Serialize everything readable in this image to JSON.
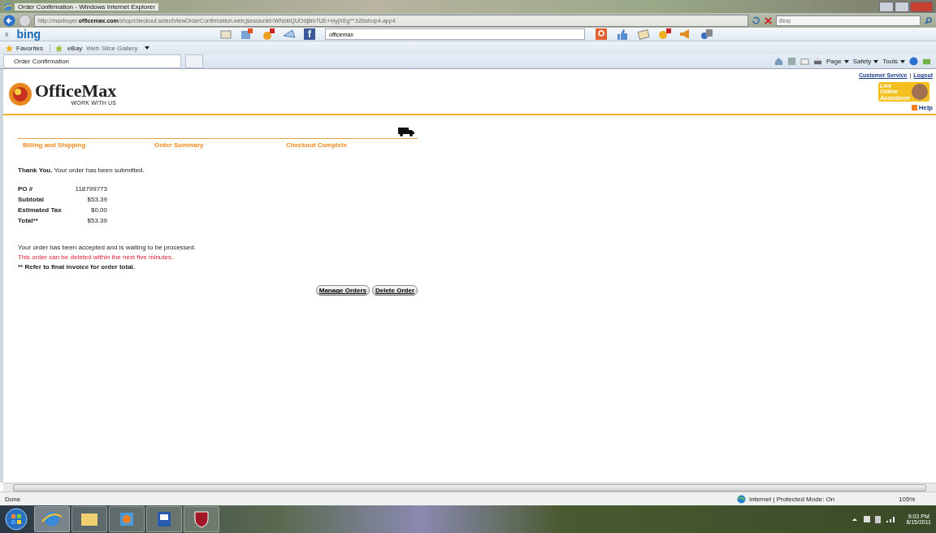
{
  "window": {
    "title": "Order Confirmation - Windows Internet Explorer"
  },
  "address_bar": {
    "url_parts": [
      {
        "text": "http://maxbuyer.",
        "emphasis": false
      },
      {
        "text": "officemax.com",
        "emphasis": true
      },
      {
        "text": "/shop/checkout.selectViewOrderConfirmation.web;jsessionid=WNzklQUOdj8m7UE+myjXEg**.b2bshop4-app4",
        "emphasis": false
      }
    ]
  },
  "search_box": {
    "placeholder": "Bing"
  },
  "bing_bar": {
    "close_glyph": "x",
    "logo": "bing",
    "search_value": "officemax",
    "facebook_glyph": "f"
  },
  "favorites_bar": {
    "favorites": "Favorites",
    "items": [
      "eBay",
      "Web Slice Gallery"
    ]
  },
  "tabs": [
    {
      "label": "Order Confirmation",
      "selected": true
    }
  ],
  "command_bar": [
    "Page",
    "Safety",
    "Tools"
  ],
  "page": {
    "logo": "OfficeMax",
    "tagline": "WORK WITH US",
    "header_links": [
      "Customer Service",
      "Logout"
    ],
    "link_separator": "|",
    "assistance": [
      "Live",
      "Online",
      "Assistance"
    ],
    "help": "Help",
    "steps": [
      "Billing and Shipping",
      "Order Summary",
      "Checkout Complete"
    ],
    "thank_you": "**Thank You.** Your order has been submitted.",
    "summary": [
      {
        "label": "PO #",
        "value": "118799773"
      },
      {
        "label": "Subtotal",
        "value": "$53.39"
      },
      {
        "label": "Estimated Tax",
        "value": "$0.00"
      },
      {
        "label": "Total**",
        "value": "$53.39"
      }
    ],
    "messages": [
      {
        "kind": "info",
        "text": "Your order has been accepted and is waiting to be processed."
      },
      {
        "kind": "warning",
        "text": "This order can be deleted within the next five minutes."
      },
      {
        "kind": "note",
        "text": "** Refer to final invoice for order total."
      }
    ],
    "buttons": [
      "Manage Orders",
      "Delete Order"
    ]
  },
  "status_bar": {
    "status": "Done",
    "zone": "Internet | Protected Mode: On",
    "zoom": "105%"
  },
  "taskbar": {
    "time": "9:03 PM",
    "date": "8/15/2011"
  }
}
